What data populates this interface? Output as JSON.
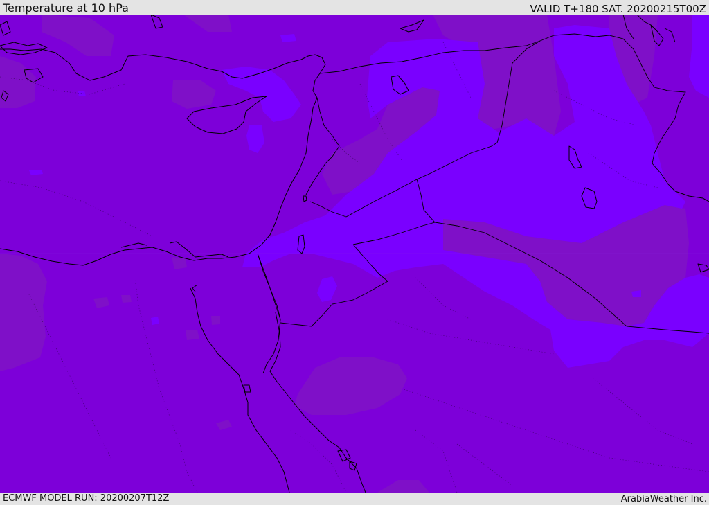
{
  "header": {
    "title": "Temperature at 10 hPa",
    "valid": "VALID T+180 SAT. 20200215T00Z"
  },
  "footer": {
    "model_run": "ECMWF MODEL RUN: 20200207T12Z",
    "credit": "ArabiaWeather Inc."
  },
  "colors": {
    "base_fill": "#7d00d9",
    "warmer_fill": "#7f10c8",
    "cooler_fill": "#7a00ff",
    "border_line": "#000000",
    "header_bg": "#e4e4e4"
  }
}
